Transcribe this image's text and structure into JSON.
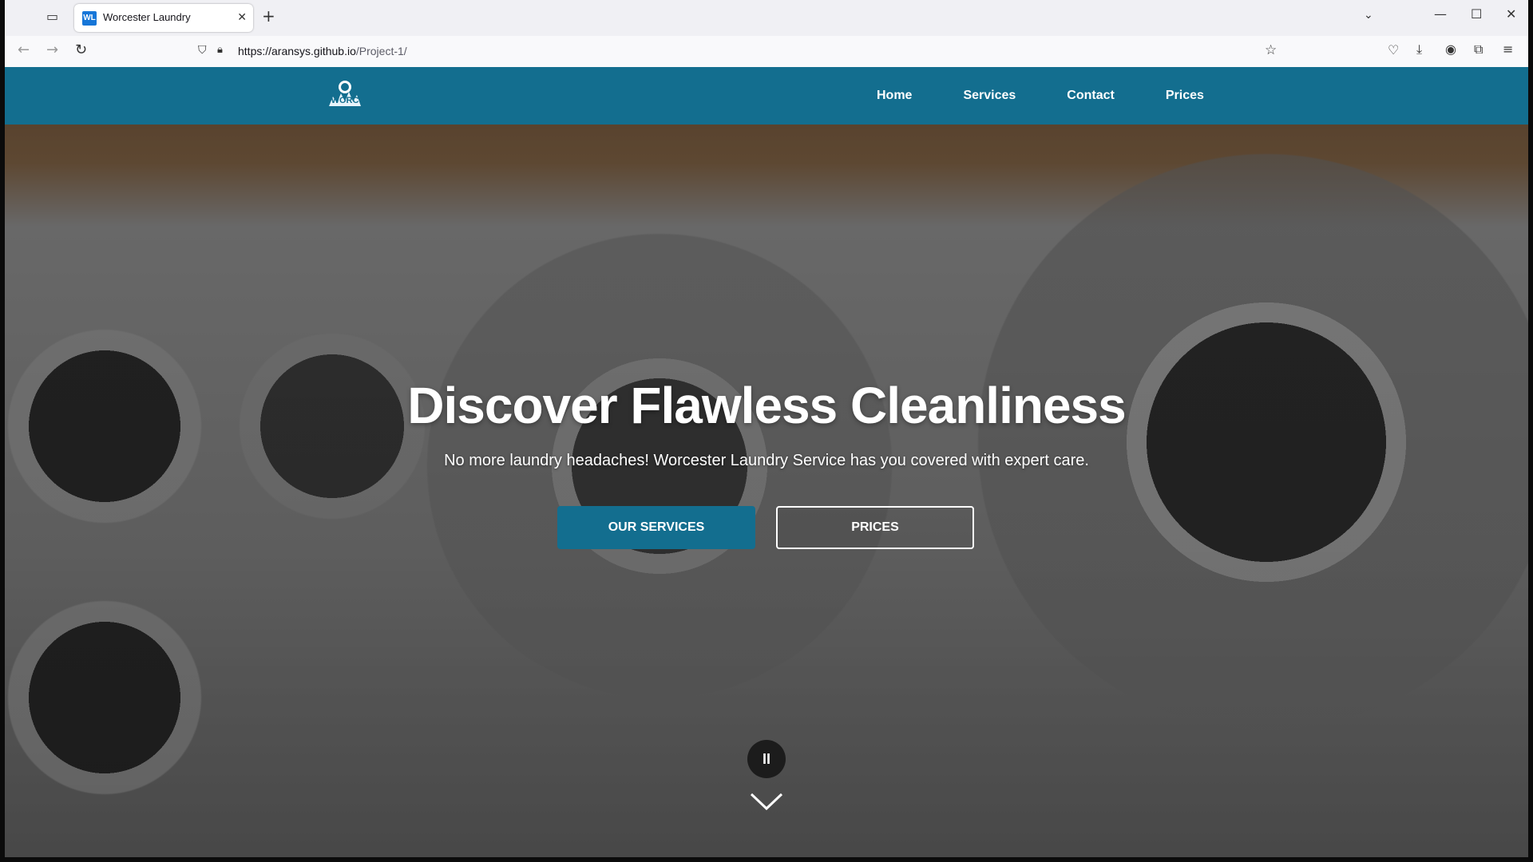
{
  "browser": {
    "tab_title": "Worcester Laundry",
    "favicon_text": "WL",
    "url_host": "https://aransys.github.io",
    "url_path": "/Project-1/",
    "new_tab_label": "+"
  },
  "site": {
    "brand_color": "#136e8f",
    "logo_text": "WORC",
    "nav": [
      {
        "label": "Home"
      },
      {
        "label": "Services"
      },
      {
        "label": "Contact"
      },
      {
        "label": "Prices"
      }
    ]
  },
  "hero": {
    "title": "Discover Flawless Cleanliness",
    "subtitle": "No more laundry headaches! Worcester Laundry Service has you covered with expert care.",
    "primary_button": "OUR SERVICES",
    "secondary_button": "PRICES",
    "pause_label": "II"
  }
}
